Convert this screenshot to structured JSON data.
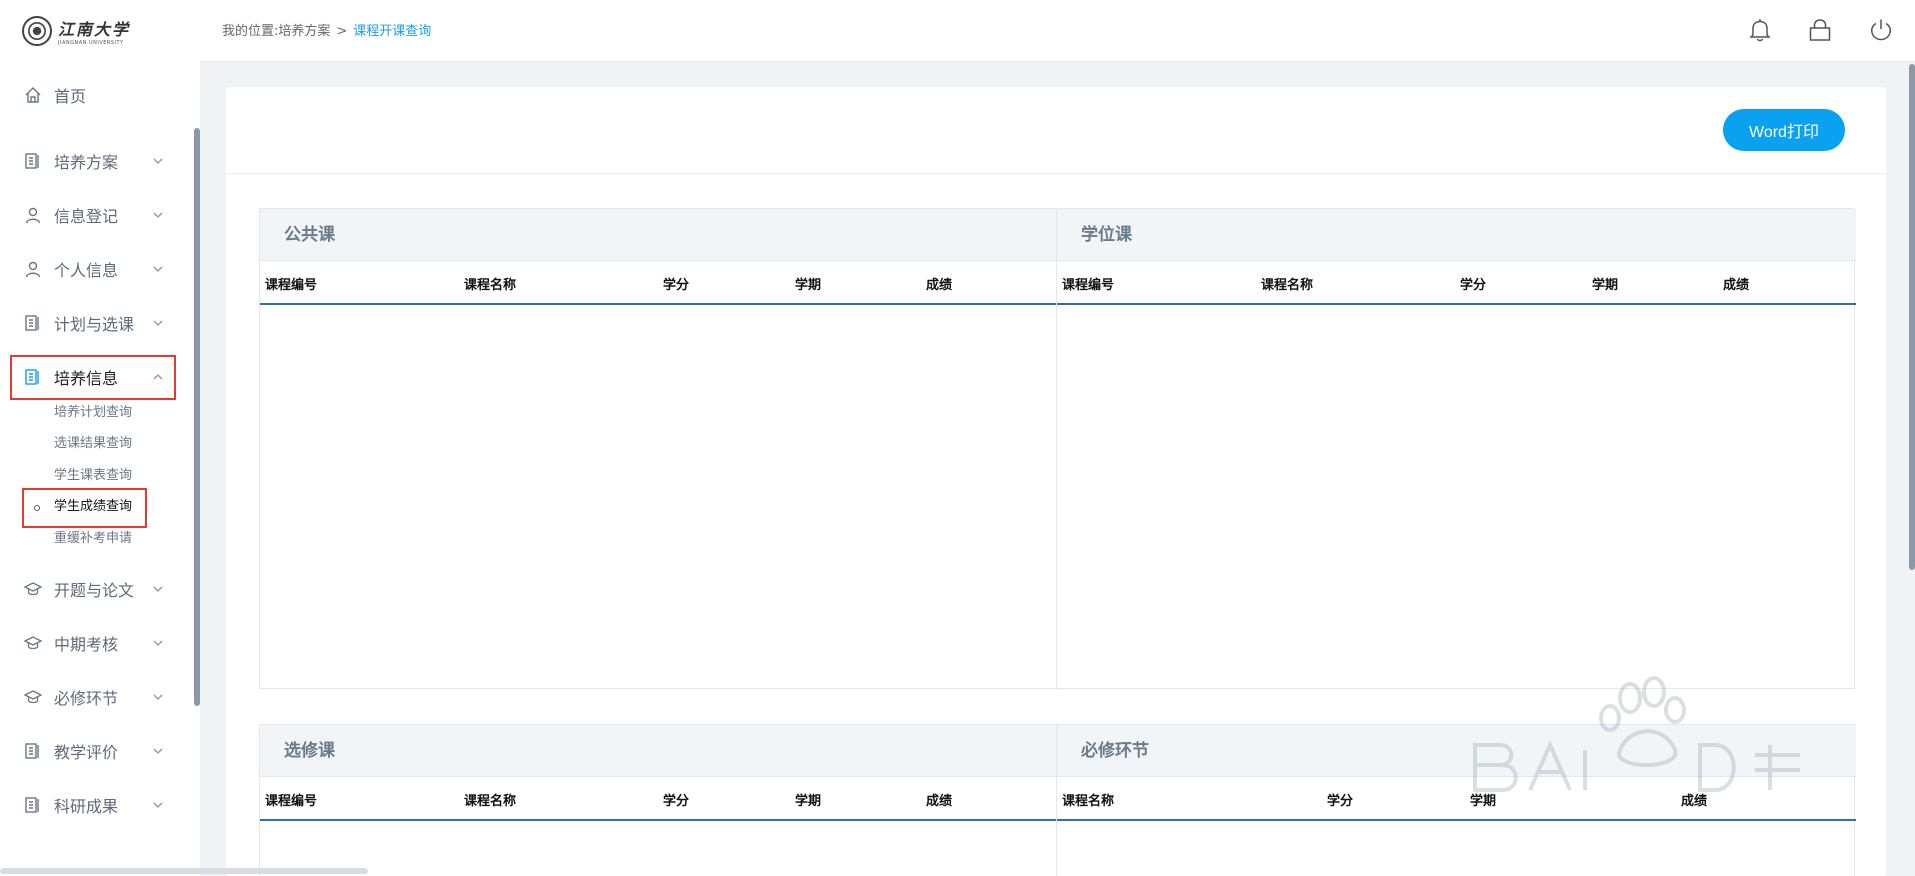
{
  "logo": {
    "name_cn": "江南大学",
    "name_en": "JIANGNAN UNIVERSITY"
  },
  "header": {
    "breadcrumb_prefix": "我的位置:培养方案",
    "breadcrumb_sep": ">",
    "breadcrumb_current": "课程开课查询"
  },
  "sidebar": {
    "items": [
      {
        "label": "首页",
        "icon": "home-icon"
      },
      {
        "label": "培养方案",
        "icon": "book-icon"
      },
      {
        "label": "信息登记",
        "icon": "user-icon"
      },
      {
        "label": "个人信息",
        "icon": "user-icon"
      },
      {
        "label": "计划与选课",
        "icon": "book-icon"
      },
      {
        "label": "培养信息",
        "icon": "book-icon"
      },
      {
        "label": "开题与论文",
        "icon": "graduation-cap-icon"
      },
      {
        "label": "中期考核",
        "icon": "graduation-cap-icon"
      },
      {
        "label": "必修环节",
        "icon": "graduation-cap-icon"
      },
      {
        "label": "教学评价",
        "icon": "book-icon"
      },
      {
        "label": "科研成果",
        "icon": "book-icon"
      }
    ],
    "sub_items": [
      "培养计划查询",
      "选课结果查询",
      "学生课表查询",
      "学生成绩查询",
      "重缓补考申请"
    ]
  },
  "toolbar": {
    "print_label": "Word打印"
  },
  "tables": {
    "public": {
      "title": "公共课",
      "cols": [
        "课程编号",
        "课程名称",
        "学分",
        "学期",
        "成绩"
      ]
    },
    "degree": {
      "title": "学位课",
      "cols": [
        "课程编号",
        "课程名称",
        "学分",
        "学期",
        "成绩"
      ]
    },
    "elective": {
      "title": "选修课",
      "cols": [
        "课程编号",
        "课程名称",
        "学分",
        "学期",
        "成绩"
      ]
    },
    "required": {
      "title": "必修环节",
      "cols": [
        "课程名称",
        "学分",
        "学期",
        "成绩"
      ]
    }
  },
  "colors": {
    "accent": "#0aa1f0",
    "highlight_box": "#e53935",
    "table_rule": "#2c6db3"
  }
}
